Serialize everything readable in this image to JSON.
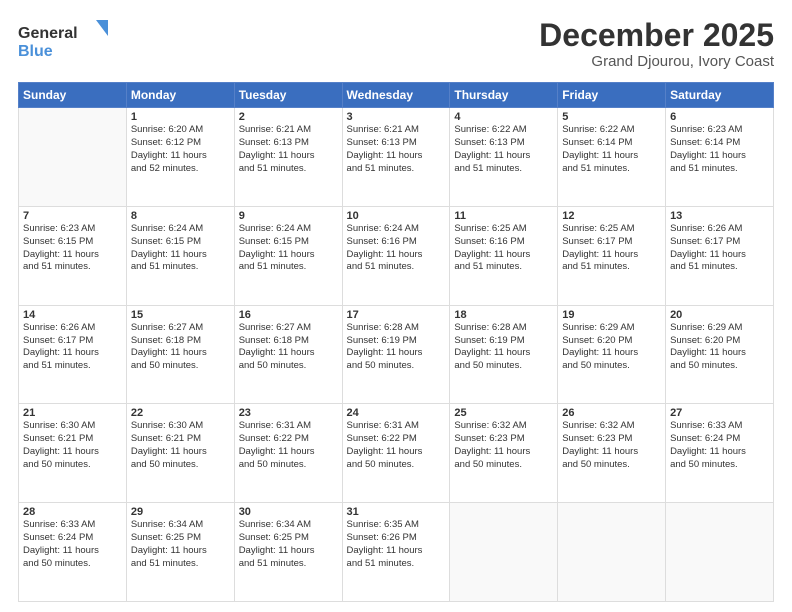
{
  "logo": {
    "line1": "General",
    "line2": "Blue"
  },
  "title": "December 2025",
  "location": "Grand Djourou, Ivory Coast",
  "days_header": [
    "Sunday",
    "Monday",
    "Tuesday",
    "Wednesday",
    "Thursday",
    "Friday",
    "Saturday"
  ],
  "weeks": [
    [
      {
        "day": "",
        "info": ""
      },
      {
        "day": "1",
        "info": "Sunrise: 6:20 AM\nSunset: 6:12 PM\nDaylight: 11 hours\nand 52 minutes."
      },
      {
        "day": "2",
        "info": "Sunrise: 6:21 AM\nSunset: 6:13 PM\nDaylight: 11 hours\nand 51 minutes."
      },
      {
        "day": "3",
        "info": "Sunrise: 6:21 AM\nSunset: 6:13 PM\nDaylight: 11 hours\nand 51 minutes."
      },
      {
        "day": "4",
        "info": "Sunrise: 6:22 AM\nSunset: 6:13 PM\nDaylight: 11 hours\nand 51 minutes."
      },
      {
        "day": "5",
        "info": "Sunrise: 6:22 AM\nSunset: 6:14 PM\nDaylight: 11 hours\nand 51 minutes."
      },
      {
        "day": "6",
        "info": "Sunrise: 6:23 AM\nSunset: 6:14 PM\nDaylight: 11 hours\nand 51 minutes."
      }
    ],
    [
      {
        "day": "7",
        "info": "Sunrise: 6:23 AM\nSunset: 6:15 PM\nDaylight: 11 hours\nand 51 minutes."
      },
      {
        "day": "8",
        "info": "Sunrise: 6:24 AM\nSunset: 6:15 PM\nDaylight: 11 hours\nand 51 minutes."
      },
      {
        "day": "9",
        "info": "Sunrise: 6:24 AM\nSunset: 6:15 PM\nDaylight: 11 hours\nand 51 minutes."
      },
      {
        "day": "10",
        "info": "Sunrise: 6:24 AM\nSunset: 6:16 PM\nDaylight: 11 hours\nand 51 minutes."
      },
      {
        "day": "11",
        "info": "Sunrise: 6:25 AM\nSunset: 6:16 PM\nDaylight: 11 hours\nand 51 minutes."
      },
      {
        "day": "12",
        "info": "Sunrise: 6:25 AM\nSunset: 6:17 PM\nDaylight: 11 hours\nand 51 minutes."
      },
      {
        "day": "13",
        "info": "Sunrise: 6:26 AM\nSunset: 6:17 PM\nDaylight: 11 hours\nand 51 minutes."
      }
    ],
    [
      {
        "day": "14",
        "info": "Sunrise: 6:26 AM\nSunset: 6:17 PM\nDaylight: 11 hours\nand 51 minutes."
      },
      {
        "day": "15",
        "info": "Sunrise: 6:27 AM\nSunset: 6:18 PM\nDaylight: 11 hours\nand 50 minutes."
      },
      {
        "day": "16",
        "info": "Sunrise: 6:27 AM\nSunset: 6:18 PM\nDaylight: 11 hours\nand 50 minutes."
      },
      {
        "day": "17",
        "info": "Sunrise: 6:28 AM\nSunset: 6:19 PM\nDaylight: 11 hours\nand 50 minutes."
      },
      {
        "day": "18",
        "info": "Sunrise: 6:28 AM\nSunset: 6:19 PM\nDaylight: 11 hours\nand 50 minutes."
      },
      {
        "day": "19",
        "info": "Sunrise: 6:29 AM\nSunset: 6:20 PM\nDaylight: 11 hours\nand 50 minutes."
      },
      {
        "day": "20",
        "info": "Sunrise: 6:29 AM\nSunset: 6:20 PM\nDaylight: 11 hours\nand 50 minutes."
      }
    ],
    [
      {
        "day": "21",
        "info": "Sunrise: 6:30 AM\nSunset: 6:21 PM\nDaylight: 11 hours\nand 50 minutes."
      },
      {
        "day": "22",
        "info": "Sunrise: 6:30 AM\nSunset: 6:21 PM\nDaylight: 11 hours\nand 50 minutes."
      },
      {
        "day": "23",
        "info": "Sunrise: 6:31 AM\nSunset: 6:22 PM\nDaylight: 11 hours\nand 50 minutes."
      },
      {
        "day": "24",
        "info": "Sunrise: 6:31 AM\nSunset: 6:22 PM\nDaylight: 11 hours\nand 50 minutes."
      },
      {
        "day": "25",
        "info": "Sunrise: 6:32 AM\nSunset: 6:23 PM\nDaylight: 11 hours\nand 50 minutes."
      },
      {
        "day": "26",
        "info": "Sunrise: 6:32 AM\nSunset: 6:23 PM\nDaylight: 11 hours\nand 50 minutes."
      },
      {
        "day": "27",
        "info": "Sunrise: 6:33 AM\nSunset: 6:24 PM\nDaylight: 11 hours\nand 50 minutes."
      }
    ],
    [
      {
        "day": "28",
        "info": "Sunrise: 6:33 AM\nSunset: 6:24 PM\nDaylight: 11 hours\nand 50 minutes."
      },
      {
        "day": "29",
        "info": "Sunrise: 6:34 AM\nSunset: 6:25 PM\nDaylight: 11 hours\nand 51 minutes."
      },
      {
        "day": "30",
        "info": "Sunrise: 6:34 AM\nSunset: 6:25 PM\nDaylight: 11 hours\nand 51 minutes."
      },
      {
        "day": "31",
        "info": "Sunrise: 6:35 AM\nSunset: 6:26 PM\nDaylight: 11 hours\nand 51 minutes."
      },
      {
        "day": "",
        "info": ""
      },
      {
        "day": "",
        "info": ""
      },
      {
        "day": "",
        "info": ""
      }
    ]
  ]
}
